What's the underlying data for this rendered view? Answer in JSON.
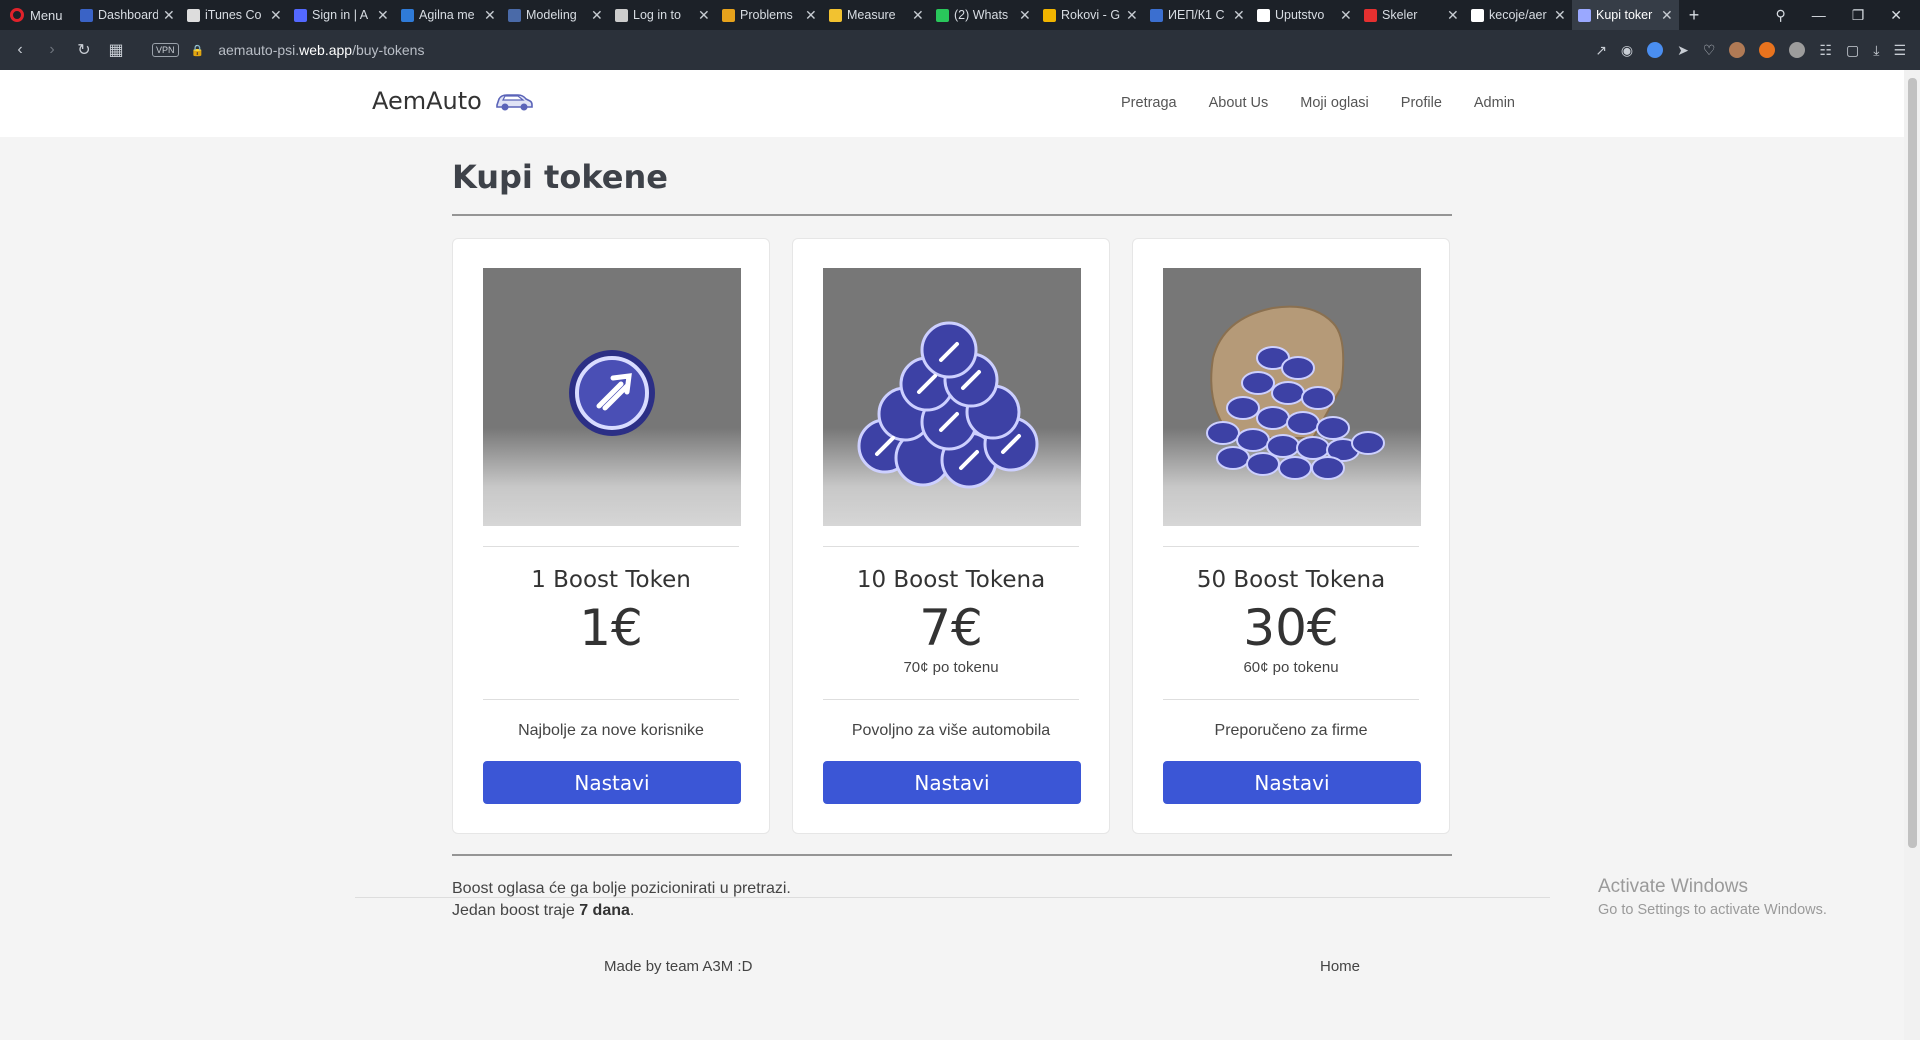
{
  "browser": {
    "menu_label": "Menu",
    "tabs": [
      {
        "title": "Dashboard",
        "color": "#3a63c6"
      },
      {
        "title": "iTunes Co",
        "color": "#dddddd"
      },
      {
        "title": "Sign in | A",
        "color": "#5368ff"
      },
      {
        "title": "Agilna me",
        "color": "#2f7bd8"
      },
      {
        "title": "Modeling",
        "color": "#4a6aa8"
      },
      {
        "title": "Log in to",
        "color": "#cccccc"
      },
      {
        "title": "Problems",
        "color": "#e6a21c"
      },
      {
        "title": "Measure",
        "color": "#f2c230"
      },
      {
        "title": "(2) Whats",
        "color": "#29c75b"
      },
      {
        "title": "Rokovi - G",
        "color": "#f0b400"
      },
      {
        "title": "ИЕП/К1 С",
        "color": "#3b6fd0"
      },
      {
        "title": "Uputstvo",
        "color": "#ffffff"
      },
      {
        "title": "Skeler",
        "color": "#e53030"
      },
      {
        "title": "kecoje/aer",
        "color": "#ffffff"
      },
      {
        "title": "Kupi toker",
        "color": "#9aa8ff",
        "active": true
      }
    ],
    "url_prefix": "aemauto-psi.",
    "url_domain": "web.app",
    "url_path": "/buy-tokens",
    "vpn_label": "VPN"
  },
  "navbar": {
    "brand": "AemAuto",
    "links": [
      "Pretraga",
      "About Us",
      "Moji oglasi",
      "Profile",
      "Admin"
    ]
  },
  "page": {
    "title": "Kupi tokene",
    "cards": [
      {
        "name": "1 Boost Token",
        "price": "1€",
        "per_token": "",
        "description": "Najbolje za nove korisnike",
        "button": "Nastavi",
        "image": "single-token"
      },
      {
        "name": "10 Boost Tokena",
        "price": "7€",
        "per_token": "70¢ po tokenu",
        "description": "Povoljno za više automobila",
        "button": "Nastavi",
        "image": "token-pile"
      },
      {
        "name": "50 Boost Tokena",
        "price": "30€",
        "per_token": "60¢ po tokenu",
        "description": "Preporučeno za firme",
        "button": "Nastavi",
        "image": "token-sack"
      }
    ],
    "info_line1": "Boost oglasa će ga bolje pozicionirati u pretrazi.",
    "info_line2_prefix": "Jedan boost traje ",
    "info_line2_bold": "7 dana",
    "info_line2_suffix": "."
  },
  "footer": {
    "made_by": "Made by team A3M :D",
    "home": "Home"
  },
  "watermark": {
    "line1": "Activate Windows",
    "line2": "Go to Settings to activate Windows."
  },
  "colors": {
    "button": "#3b56d6",
    "token": "#3b3f9e"
  }
}
